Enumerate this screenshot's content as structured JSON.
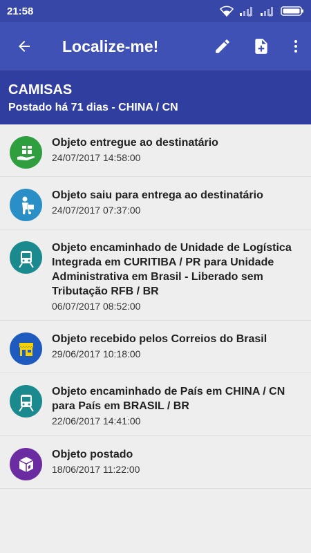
{
  "status_bar": {
    "time": "21:58"
  },
  "toolbar": {
    "title": "Localize-me!"
  },
  "header": {
    "name": "CAMISAS",
    "subtitle": "Postado há 71 dias - CHINA / CN"
  },
  "events": [
    {
      "description": "Objeto entregue ao destinatário",
      "date": "24/07/2017 14:58:00",
      "icon": "gift-hand-icon",
      "color": "#2e9e3e"
    },
    {
      "description": "Objeto saiu para entrega ao destinatário",
      "date": "24/07/2017 07:37:00",
      "icon": "delivery-person-icon",
      "color": "#2a8fc7"
    },
    {
      "description": "Objeto encaminhado de Unidade de Logística Integrada em CURITIBA / PR para Unidade Administrativa em Brasil - Liberado sem Tributação RFB / BR",
      "date": "06/07/2017 08:52:00",
      "icon": "bus-icon",
      "color": "#1a8a8f"
    },
    {
      "description": "Objeto recebido pelos Correios do Brasil",
      "date": "29/06/2017 10:18:00",
      "icon": "post-office-icon",
      "color": "#1f5bbf"
    },
    {
      "description": "Objeto encaminhado de País em CHINA / CN para País em BRASIL / BR",
      "date": "22/06/2017 14:41:00",
      "icon": "bus-icon",
      "color": "#1a8a8f"
    },
    {
      "description": "Objeto postado",
      "date": "18/06/2017 11:22:00",
      "icon": "package-icon",
      "color": "#6a2ca0"
    }
  ]
}
